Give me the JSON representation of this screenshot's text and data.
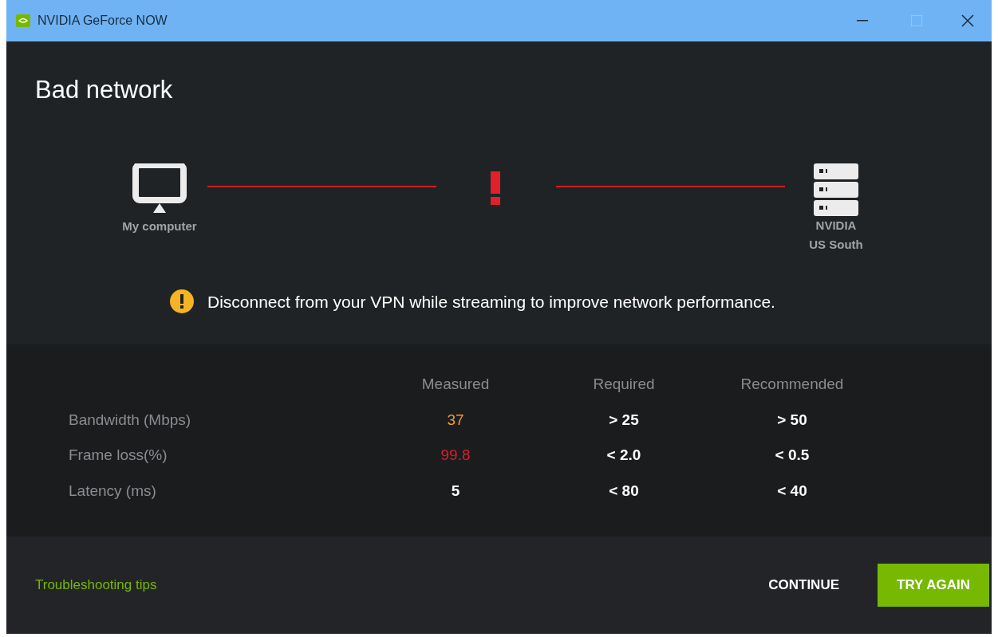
{
  "window": {
    "title": "NVIDIA GeForce NOW"
  },
  "heading": "Bad network",
  "diagram": {
    "client_label": "My computer",
    "server_label": [
      "NVIDIA",
      "US South"
    ]
  },
  "notice": "Disconnect from your VPN while streaming to improve network performance.",
  "table": {
    "columns": [
      "Measured",
      "Required",
      "Recommended"
    ],
    "rows": [
      {
        "label": "Bandwidth (Mbps)",
        "measured": "37",
        "color": "#f0a030",
        "required": "> 25",
        "recommended": "> 50"
      },
      {
        "label": "Frame loss(%)",
        "measured": "99.8",
        "color": "#d8202a",
        "required": "< 2.0",
        "recommended": "< 0.5"
      },
      {
        "label": "Latency (ms)",
        "measured": "5",
        "color": "#ffffff",
        "required": "< 80",
        "recommended": "< 40"
      }
    ]
  },
  "footer": {
    "link": "Troubleshooting tips",
    "buttons": [
      "CONTINUE",
      "TRY AGAIN"
    ]
  }
}
